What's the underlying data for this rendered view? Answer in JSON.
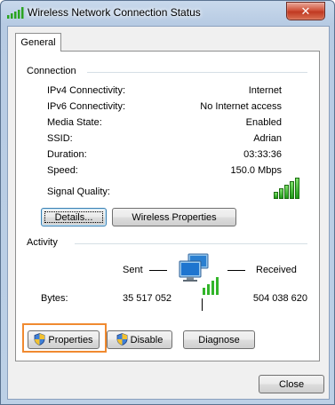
{
  "window": {
    "title": "Wireless Network Connection Status",
    "close_glyph": "✕"
  },
  "tabs": [
    {
      "label": "General"
    }
  ],
  "connection": {
    "label": "Connection",
    "rows": [
      {
        "label": "IPv4 Connectivity:",
        "value": "Internet"
      },
      {
        "label": "IPv6 Connectivity:",
        "value": "No Internet access"
      },
      {
        "label": "Media State:",
        "value": "Enabled"
      },
      {
        "label": "SSID:",
        "value": "Adrian"
      },
      {
        "label": "Duration:",
        "value": "03:33:36"
      },
      {
        "label": "Speed:",
        "value": "150.0 Mbps"
      }
    ],
    "signal_quality_label": "Signal Quality:",
    "signal_bars_lit": 5,
    "signal_bars_total": 5,
    "details_button": "Details...",
    "wireless_properties_button": "Wireless Properties"
  },
  "activity": {
    "label": "Activity",
    "sent_label": "Sent",
    "received_label": "Received",
    "bytes_label": "Bytes:",
    "bytes_sent": "35 517 052",
    "bytes_received": "504 038 620"
  },
  "actions": {
    "properties_button": "Properties",
    "disable_button": "Disable",
    "diagnose_button": "Diagnose"
  },
  "footer": {
    "close_button": "Close"
  },
  "colors": {
    "highlight": "#f08a30",
    "signal_green": "#3cbf2a"
  },
  "icons": [
    "signal-strength-icon",
    "network-computer-icon",
    "uac-shield-icon"
  ]
}
